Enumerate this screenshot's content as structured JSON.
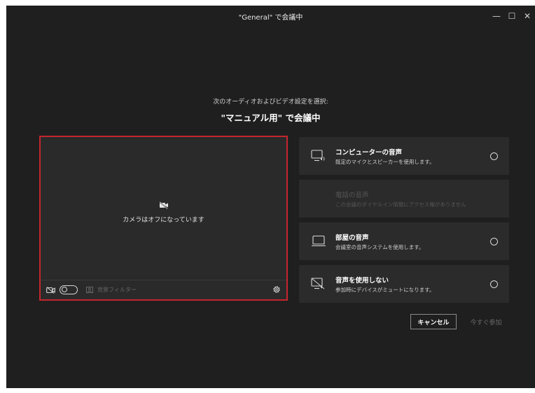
{
  "window": {
    "title": "\"General\" で会議中",
    "controls": [
      "—",
      "☐",
      "✕"
    ]
  },
  "intro": {
    "subtitle": "次のオーディオおよびビデオ設定を選択:",
    "heading": "\"マニュアル用\" で会議中"
  },
  "preview": {
    "camera_off_text": "カメラはオフになっています",
    "background_filter_label": "背景フィルター",
    "camera_toggle": false
  },
  "audio_options": [
    {
      "title": "コンピューターの音声",
      "desc": "既定のマイクとスピーカーを使用します。",
      "icon": "computer-audio-icon",
      "enabled": true
    },
    {
      "title": "電話の音声",
      "desc": "この会議のダイヤルイン情報にアクセス権がありません",
      "icon": "",
      "enabled": false
    },
    {
      "title": "部屋の音声",
      "desc": "会議室の音声システムを使用します。",
      "icon": "room-audio-icon",
      "enabled": true
    },
    {
      "title": "音声を使用しない",
      "desc": "参加時にデバイスがミュートになります。",
      "icon": "no-audio-icon",
      "enabled": true
    }
  ],
  "buttons": {
    "cancel": "キャンセル",
    "join": "今すぐ参加"
  },
  "colors": {
    "background": "#1f1f1f",
    "panel": "#2b2b2b",
    "highlight_border": "#c4262e"
  }
}
